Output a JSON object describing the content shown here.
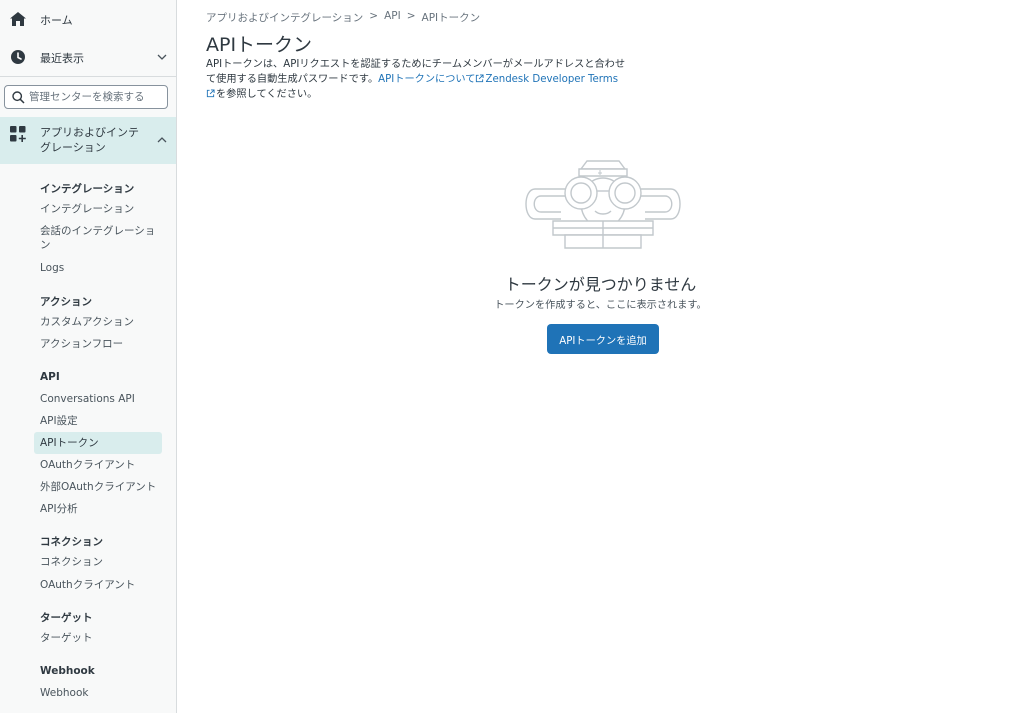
{
  "sidebar": {
    "home_label": "ホーム",
    "recent_label": "最近表示",
    "search_placeholder": "管理センターを検索する",
    "active_group_label": "アプリおよびインテグレーション",
    "sections": {
      "integrations": {
        "heading": "インテグレーション",
        "items": [
          "インテグレーション",
          "会話のインテグレーション",
          "Logs"
        ]
      },
      "actions": {
        "heading": "アクション",
        "items": [
          "カスタムアクション",
          "アクションフロー"
        ]
      },
      "api": {
        "heading": "API",
        "items": [
          "Conversations API",
          "API設定",
          "APIトークン",
          "OAuthクライアント",
          "外部OAuthクライアント",
          "API分析"
        ]
      },
      "connections": {
        "heading": "コネクション",
        "items": [
          "コネクション",
          "OAuthクライアント"
        ]
      },
      "targets": {
        "heading": "ターゲット",
        "items": [
          "ターゲット"
        ]
      },
      "webhooks": {
        "heading": "Webhook",
        "items": [
          "Webhook"
        ]
      }
    }
  },
  "main": {
    "breadcrumb": [
      "アプリおよびインテグレーション",
      "API",
      "APIトークン"
    ],
    "breadcrumb_sep": ">",
    "title": "APIトークン",
    "description": {
      "text": "APIトークンは、APIリクエストを認証するためにチームメンバーがメールアドレスと合わせて使用する自動生成パスワードです。",
      "link1": "APIトークンについて",
      "link2": "Zendesk Developer Terms",
      "suffix": "を参照してください。"
    },
    "empty_title": "トークンが見つかりません",
    "empty_subtitle": "トークンを作成すると、ここに表示されます。",
    "add_button": "APIトークンを追加"
  },
  "colors": {
    "accent": "#1f73b7",
    "active_bg": "#d9eded",
    "sidebar_bg": "#f8f9f9"
  },
  "icons": [
    "home-icon",
    "clock-icon",
    "chevron-down-icon",
    "search-icon",
    "apps-icon",
    "chevron-up-icon",
    "external-link-icon"
  ]
}
